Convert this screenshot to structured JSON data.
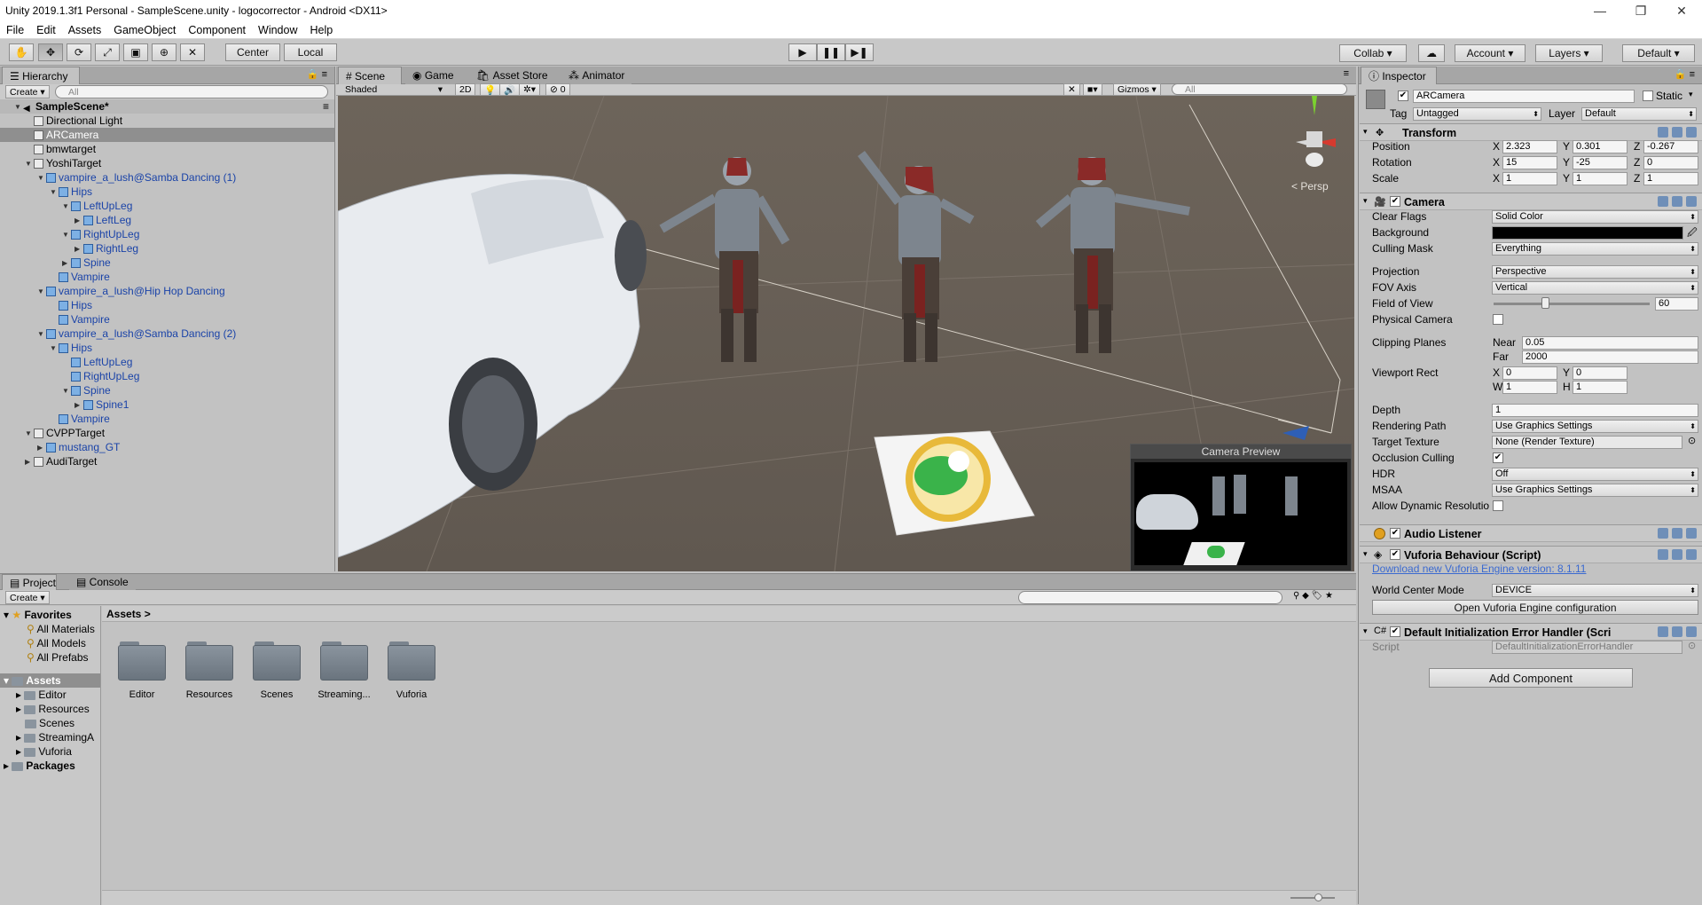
{
  "window": {
    "title": "Unity 2019.1.3f1 Personal - SampleScene.unity - logocorrector - Android <DX11>"
  },
  "menu": [
    "File",
    "Edit",
    "Assets",
    "GameObject",
    "Component",
    "Window",
    "Help"
  ],
  "toolbar": {
    "center": "Center",
    "local": "Local",
    "collab": "Collab",
    "account": "Account",
    "layers": "Layers",
    "layout": "Default"
  },
  "hierarchy": {
    "tab": "Hierarchy",
    "create": "Create",
    "search_placeholder": "All",
    "items": [
      {
        "label": "SampleScene*",
        "depth": 0
      },
      {
        "label": "Directional Light",
        "depth": 1
      },
      {
        "label": "ARCamera",
        "depth": 1
      },
      {
        "label": "bmwtarget",
        "depth": 1
      },
      {
        "label": "YoshiTarget",
        "depth": 1
      },
      {
        "label": "vampire_a_lush@Samba Dancing (1)",
        "depth": 2
      },
      {
        "label": "Hips",
        "depth": 3
      },
      {
        "label": "LeftUpLeg",
        "depth": 4
      },
      {
        "label": "LeftLeg",
        "depth": 5
      },
      {
        "label": "RightUpLeg",
        "depth": 4
      },
      {
        "label": "RightLeg",
        "depth": 5
      },
      {
        "label": "Spine",
        "depth": 4
      },
      {
        "label": "Vampire",
        "depth": 3
      },
      {
        "label": "vampire_a_lush@Hip Hop Dancing",
        "depth": 2
      },
      {
        "label": "Hips",
        "depth": 3
      },
      {
        "label": "Vampire",
        "depth": 3
      },
      {
        "label": "vampire_a_lush@Samba Dancing (2)",
        "depth": 2
      },
      {
        "label": "Hips",
        "depth": 3
      },
      {
        "label": "LeftUpLeg",
        "depth": 4
      },
      {
        "label": "RightUpLeg",
        "depth": 4
      },
      {
        "label": "Spine",
        "depth": 4
      },
      {
        "label": "Spine1",
        "depth": 5
      },
      {
        "label": "Vampire",
        "depth": 3
      },
      {
        "label": "CVPPTarget",
        "depth": 1
      },
      {
        "label": "mustang_GT",
        "depth": 2
      },
      {
        "label": "AudiTarget",
        "depth": 1
      }
    ]
  },
  "scene": {
    "tabs": [
      "Scene",
      "Game",
      "Asset Store",
      "Animator"
    ],
    "shading": "Shaded",
    "mode2d": "2D",
    "fx_count": "0",
    "gizmos": "Gizmos",
    "search_placeholder": "All",
    "persp_label": "< Persp",
    "camera_preview_title": "Camera Preview"
  },
  "project": {
    "tabs": [
      "Project",
      "Console"
    ],
    "create": "Create",
    "favorites_title": "Favorites",
    "favorites": [
      "All Materials",
      "All Models",
      "All Prefabs"
    ],
    "assets_title": "Assets",
    "asset_tree": [
      "Editor",
      "Resources",
      "Scenes",
      "StreamingA",
      "Vuforia"
    ],
    "packages_title": "Packages",
    "breadcrumb": "Assets",
    "folders": [
      "Editor",
      "Resources",
      "Scenes",
      "Streaming...",
      "Vuforia"
    ]
  },
  "inspector": {
    "tab": "Inspector",
    "object_name": "ARCamera",
    "static_label": "Static",
    "tag_label": "Tag",
    "tag_value": "Untagged",
    "layer_label": "Layer",
    "layer_value": "Default",
    "transform": {
      "title": "Transform",
      "position_label": "Position",
      "position": [
        "2.323",
        "0.301",
        "-0.267"
      ],
      "rotation_label": "Rotation",
      "rotation": [
        "15",
        "-25",
        "0"
      ],
      "scale_label": "Scale",
      "scale": [
        "1",
        "1",
        "1"
      ]
    },
    "camera": {
      "title": "Camera",
      "clear_flags_label": "Clear Flags",
      "clear_flags": "Solid Color",
      "background_label": "Background",
      "culling_mask_label": "Culling Mask",
      "culling_mask": "Everything",
      "projection_label": "Projection",
      "projection": "Perspective",
      "fov_axis_label": "FOV Axis",
      "fov_axis": "Vertical",
      "fov_label": "Field of View",
      "fov": "60",
      "fov_fraction": 0.33,
      "physical_camera_label": "Physical Camera",
      "clipping_label": "Clipping Planes",
      "near_label": "Near",
      "near": "0.05",
      "far_label": "Far",
      "far": "2000",
      "viewport_label": "Viewport Rect",
      "vx": "0",
      "vy": "0",
      "vw": "1",
      "vh": "1",
      "depth_label": "Depth",
      "depth": "1",
      "rendering_path_label": "Rendering Path",
      "rendering_path": "Use Graphics Settings",
      "target_texture_label": "Target Texture",
      "target_texture": "None (Render Texture)",
      "occlusion_label": "Occlusion Culling",
      "hdr_label": "HDR",
      "hdr": "Off",
      "msaa_label": "MSAA",
      "msaa": "Use Graphics Settings",
      "dynamic_res_label": "Allow Dynamic Resolutio"
    },
    "audio_listener": "Audio Listener",
    "vuforia": {
      "title": "Vuforia Behaviour (Script)",
      "download_link": "Download new Vuforia Engine version: 8.1.11",
      "world_center_label": "World Center Mode",
      "world_center": "DEVICE",
      "open_config": "Open Vuforia Engine configuration"
    },
    "error_handler": {
      "title": "Default Initialization Error Handler (Scri",
      "script_label": "Script",
      "script_value": "DefaultInitializationErrorHandler"
    },
    "add_component": "Add Component"
  },
  "colors": {
    "accent_blue": "#1a43a8",
    "selection": "#8f8f8f",
    "scene_bg": "#655c53"
  }
}
